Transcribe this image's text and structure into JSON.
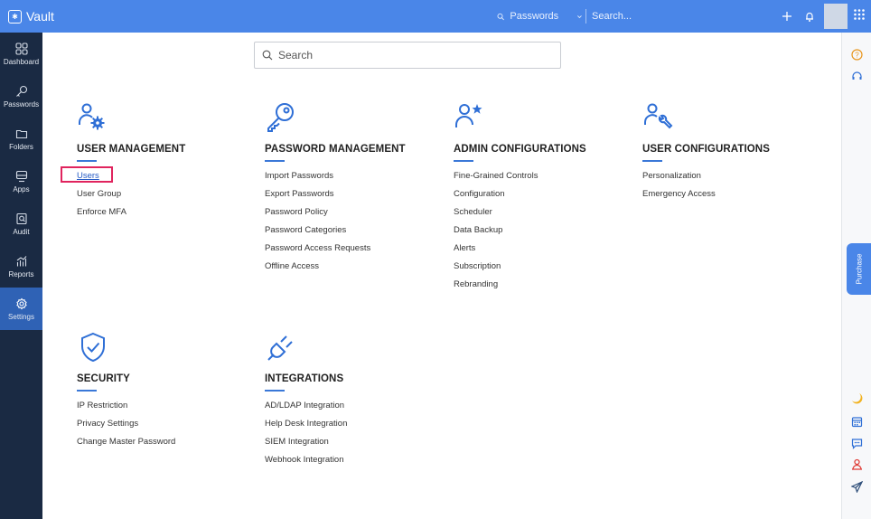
{
  "app": {
    "name": "Vault"
  },
  "topbar": {
    "search_scope": "Passwords",
    "search_placeholder": "Search...",
    "add_icon": "plus-icon",
    "notifications_icon": "bell-icon",
    "apps_icon": "grid-icon"
  },
  "leftnav": [
    {
      "label": "Dashboard",
      "icon": "dashboard-icon",
      "active": false
    },
    {
      "label": "Passwords",
      "icon": "key-icon",
      "active": false
    },
    {
      "label": "Folders",
      "icon": "folder-icon",
      "active": false
    },
    {
      "label": "Apps",
      "icon": "apps-icon",
      "active": false
    },
    {
      "label": "Audit",
      "icon": "audit-icon",
      "active": false
    },
    {
      "label": "Reports",
      "icon": "reports-icon",
      "active": false
    },
    {
      "label": "Settings",
      "icon": "settings-icon",
      "active": true
    }
  ],
  "main": {
    "search_placeholder": "Search",
    "sections": [
      {
        "title": "USER MANAGEMENT",
        "icon": "user-gear-icon",
        "links": [
          "Users",
          "User Group",
          "Enforce MFA"
        ]
      },
      {
        "title": "PASSWORD MANAGEMENT",
        "icon": "key-icon",
        "links": [
          "Import Passwords",
          "Export Passwords",
          "Password Policy",
          "Password Categories",
          "Password Access Requests",
          "Offline Access"
        ]
      },
      {
        "title": "ADMIN CONFIGURATIONS",
        "icon": "user-star-icon",
        "links": [
          "Fine-Grained Controls",
          "Configuration",
          "Scheduler",
          "Data Backup",
          "Alerts",
          "Subscription",
          "Rebranding"
        ]
      },
      {
        "title": "USER CONFIGURATIONS",
        "icon": "user-wrench-icon",
        "links": [
          "Personalization",
          "Emergency Access"
        ]
      },
      {
        "title": "SECURITY",
        "icon": "shield-check-icon",
        "links": [
          "IP Restriction",
          "Privacy Settings",
          "Change Master Password"
        ]
      },
      {
        "title": "INTEGRATIONS",
        "icon": "plug-icon",
        "links": [
          "AD/LDAP Integration",
          "Help Desk Integration",
          "SIEM Integration",
          "Webhook Integration"
        ]
      }
    ]
  },
  "rightrail": {
    "purchase_label": "Purchase",
    "icons": [
      "help-icon",
      "support-icon",
      "moon-icon",
      "calendar-icon",
      "chat-icon",
      "user-pin-icon",
      "send-icon"
    ]
  },
  "colors": {
    "accent": "#4a86e8",
    "nav_bg": "#1a2a43",
    "active_nav": "#2f62b5",
    "highlight_box": "#e0245e"
  }
}
